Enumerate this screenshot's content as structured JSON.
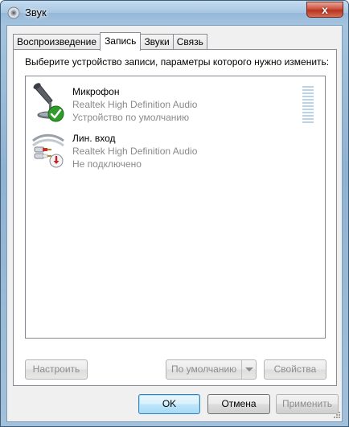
{
  "window": {
    "title": "Звук",
    "close_label": "x"
  },
  "tabs": [
    {
      "label": "Воспроизведение",
      "active": false
    },
    {
      "label": "Запись",
      "active": true
    },
    {
      "label": "Звуки",
      "active": false
    },
    {
      "label": "Связь",
      "active": false
    }
  ],
  "panel": {
    "instruction": "Выберите устройство записи, параметры которого нужно изменить:"
  },
  "devices": [
    {
      "name": "Микрофон",
      "driver": "Realtek High Definition Audio",
      "status": "Устройство по умолчанию",
      "icon": "microphone-icon",
      "badge": "default-check-icon"
    },
    {
      "name": "Лин. вход",
      "driver": "Realtek High Definition Audio",
      "status": "Не подключено",
      "icon": "line-in-cable-icon",
      "badge": "unplugged-arrow-icon"
    }
  ],
  "panel_buttons": {
    "configure": "Настроить",
    "set_default": "По умолчанию",
    "properties": "Свойства"
  },
  "dialog_buttons": {
    "ok": "OK",
    "cancel": "Отмена",
    "apply": "Применить"
  },
  "colors": {
    "accent_check": "#2e9b2a",
    "unplugged_badge": "#c8202a",
    "level_meter": "#b9d4e8"
  }
}
